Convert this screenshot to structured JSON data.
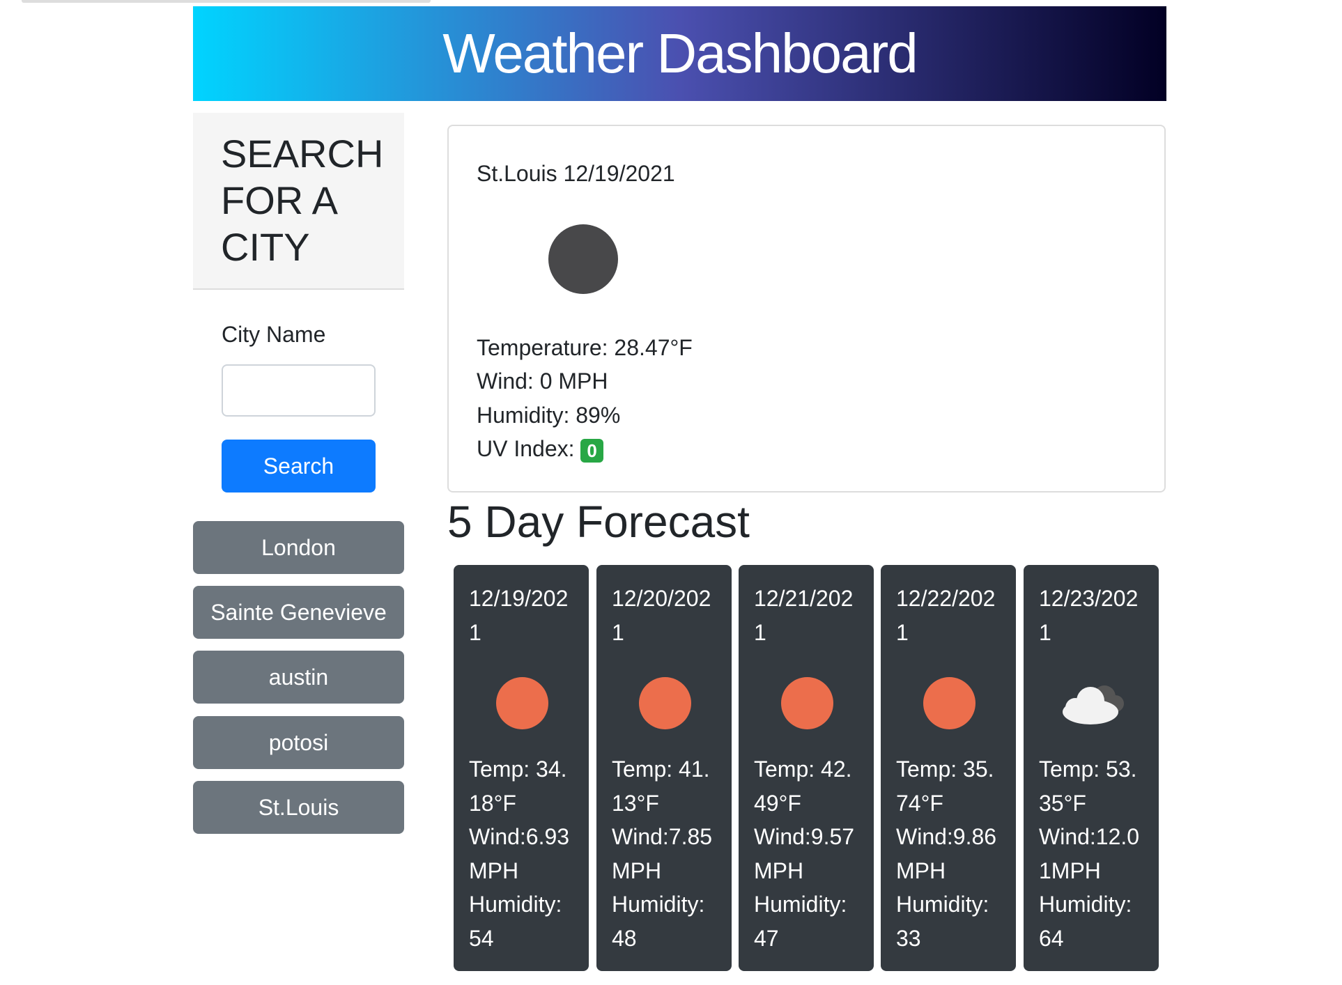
{
  "header": {
    "title": "Weather Dashboard"
  },
  "sidebar": {
    "title": "SEARCH FOR A CITY",
    "city_label": "City Name",
    "city_value": "",
    "search_label": "Search",
    "history": [
      "London",
      "Sainte Genevieve",
      "austin",
      "potosi",
      "St.Louis"
    ]
  },
  "current": {
    "heading": "St.Louis 12/19/2021",
    "icon": "dark-circle-icon",
    "temperature": "Temperature: 28.47°F",
    "wind": "Wind: 0 MPH",
    "humidity": "Humidity: 89%",
    "uv_label": "UV Index:",
    "uv_value": "0",
    "uv_color": "#28a745"
  },
  "forecast": {
    "title": "5 Day Forecast",
    "days": [
      {
        "date": "12/19/2021",
        "icon": "sun-icon",
        "temp": "Temp: 34.18°F",
        "wind": "Wind:6.93 MPH",
        "humidity": "Humidity: 54"
      },
      {
        "date": "12/20/2021",
        "icon": "sun-icon",
        "temp": "Temp: 41.13°F",
        "wind": "Wind:7.85 MPH",
        "humidity": "Humidity: 48"
      },
      {
        "date": "12/21/2021",
        "icon": "sun-icon",
        "temp": "Temp: 42.49°F",
        "wind": "Wind:9.57 MPH",
        "humidity": "Humidity: 47"
      },
      {
        "date": "12/22/2021",
        "icon": "sun-icon",
        "temp": "Temp: 35.74°F",
        "wind": "Wind:9.86 MPH",
        "humidity": "Humidity: 33"
      },
      {
        "date": "12/23/2021",
        "icon": "cloud-icon",
        "temp": "Temp: 53.35°F",
        "wind": "Wind:12.01MPH",
        "humidity": "Humidity: 64"
      }
    ]
  }
}
